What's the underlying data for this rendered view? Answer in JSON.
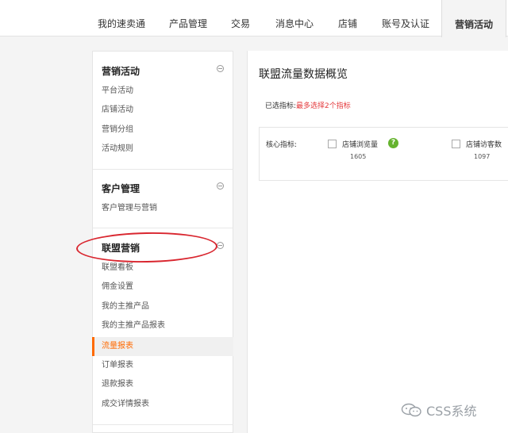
{
  "topnav": {
    "tabs": [
      {
        "label": "我的速卖通"
      },
      {
        "label": "产品管理"
      },
      {
        "label": "交易"
      },
      {
        "label": "消息中心"
      },
      {
        "label": "店铺"
      },
      {
        "label": "账号及认证"
      },
      {
        "label": "营销活动",
        "active": true
      }
    ]
  },
  "sidebar": {
    "sections": [
      {
        "title": "营销活动",
        "items": [
          "平台活动",
          "店铺活动",
          "营销分组",
          "活动规则"
        ]
      },
      {
        "title": "客户管理",
        "items": [
          "客户管理与营销"
        ]
      },
      {
        "title": "联盟营销",
        "items": [
          "联盟看板",
          "佣金设置",
          "我的主推产品",
          "我的主推产品报表",
          "流量报表",
          "订单报表",
          "退款报表",
          "成交详情报表"
        ]
      }
    ],
    "active_item": "流量报表"
  },
  "main": {
    "title": "联盟流量数据概览",
    "selected_label": "已选指标:",
    "selected_hint": "最多选择2个指标",
    "core_label": "核心指标:",
    "metrics": [
      {
        "name": "店铺浏览量",
        "value": "1605"
      },
      {
        "name": "店铺访客数",
        "value": "1097"
      }
    ]
  },
  "watermark": {
    "text": "CSS系统"
  },
  "colors": {
    "accent": "#ff6a00",
    "hint_red": "#e4393c",
    "annotation_red": "#d9262f",
    "help_green": "#65b32e"
  },
  "icons": {
    "collapse": "minus-circle-icon",
    "help": "question-icon",
    "watermark": "wechat-icon"
  }
}
